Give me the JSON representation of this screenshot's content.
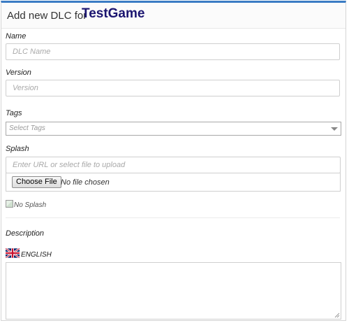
{
  "header": {
    "prefix": "Add new DLC for",
    "game_name": "TestGame"
  },
  "form": {
    "name": {
      "label": "Name",
      "placeholder": "DLC Name",
      "value": ""
    },
    "version": {
      "label": "Version",
      "placeholder": "Version",
      "value": ""
    },
    "tags": {
      "label": "Tags",
      "placeholder": "Select Tags"
    },
    "splash": {
      "label": "Splash",
      "url_placeholder": "Enter URL or select file to upload",
      "choose_file_label": "Choose File",
      "file_status": "No file chosen",
      "preview_alt": "No Splash"
    },
    "description": {
      "label": "Description",
      "language": "ENGLISH",
      "value": ""
    }
  },
  "colors": {
    "accent_top_border": "#3a7cc4",
    "game_name": "#1b1570"
  },
  "icons": {
    "flag": "uk-flag-icon",
    "dropdown": "caret-down-icon",
    "broken_image": "broken-image-icon",
    "resize": "resize-grip-icon"
  }
}
